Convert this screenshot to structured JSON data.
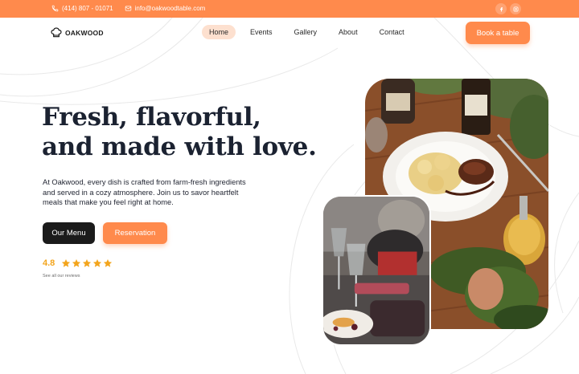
{
  "topbar": {
    "phone": "(414) 807 - 01071",
    "email": "info@oakwoodtable.com",
    "phone_icon": "phone-icon",
    "email_icon": "mail-icon",
    "social": [
      "facebook-icon",
      "instagram-icon"
    ]
  },
  "brand": {
    "name": "OAKWOOD"
  },
  "nav": {
    "items": [
      {
        "label": "Home",
        "active": true
      },
      {
        "label": "Events",
        "active": false
      },
      {
        "label": "Gallery",
        "active": false
      },
      {
        "label": "About",
        "active": false
      },
      {
        "label": "Contact",
        "active": false
      }
    ],
    "cta": "Book a table"
  },
  "hero": {
    "title_line1": "Fresh, flavorful,",
    "title_line2": "and made with love.",
    "description": "At Oakwood, every dish is crafted from farm-fresh ingredients and served in a cozy atmosphere. Join us to savor heartfelt meals that make you feel right at home.",
    "primary_button": "Our Menu",
    "secondary_button": "Reservation",
    "rating": "4.8",
    "stars": 5,
    "reviews_link": "See all our reviews"
  },
  "colors": {
    "accent": "#ff8a4c",
    "accent_light": "#fde0cf",
    "dark": "#1b1b1b",
    "star": "#f3a51d",
    "heading": "#1b2231"
  }
}
